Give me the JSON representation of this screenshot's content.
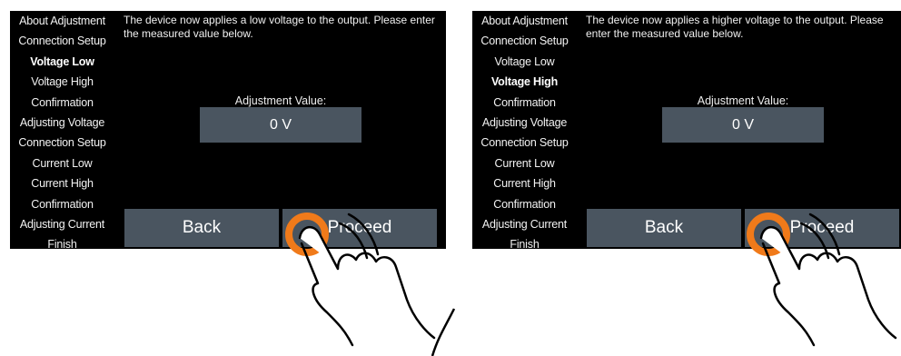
{
  "screens": [
    {
      "sidebar": {
        "items": [
          {
            "label": "About Adjustment",
            "active": false
          },
          {
            "label": "Connection Setup",
            "active": false
          },
          {
            "label": "Voltage Low",
            "active": true
          },
          {
            "label": "Voltage High",
            "active": false
          },
          {
            "label": "Confirmation",
            "active": false
          },
          {
            "label": "Adjusting Voltage",
            "active": false
          },
          {
            "label": "Connection Setup",
            "active": false
          },
          {
            "label": "Current Low",
            "active": false
          },
          {
            "label": "Current High",
            "active": false
          },
          {
            "label": "Confirmation",
            "active": false
          },
          {
            "label": "Adjusting Current",
            "active": false
          },
          {
            "label": "Finish",
            "active": false
          }
        ]
      },
      "message": "The device now applies a low voltage to the output. Please enter the measured value below.",
      "adjustment": {
        "label": "Adjustment Value:",
        "value": "0 V"
      },
      "buttons": {
        "back": "Back",
        "proceed": "Proceed"
      }
    },
    {
      "sidebar": {
        "items": [
          {
            "label": "About Adjustment",
            "active": false
          },
          {
            "label": "Connection Setup",
            "active": false
          },
          {
            "label": "Voltage Low",
            "active": false
          },
          {
            "label": "Voltage High",
            "active": true
          },
          {
            "label": "Confirmation",
            "active": false
          },
          {
            "label": "Adjusting Voltage",
            "active": false
          },
          {
            "label": "Connection Setup",
            "active": false
          },
          {
            "label": "Current Low",
            "active": false
          },
          {
            "label": "Current High",
            "active": false
          },
          {
            "label": "Confirmation",
            "active": false
          },
          {
            "label": "Adjusting Current",
            "active": false
          },
          {
            "label": "Finish",
            "active": false
          }
        ]
      },
      "message": "The device now applies a higher voltage to the output. Please enter the measured value below.",
      "adjustment": {
        "label": "Adjustment Value:",
        "value": "0 V"
      },
      "buttons": {
        "back": "Back",
        "proceed": "Proceed"
      }
    }
  ],
  "colors": {
    "screen_bg": "#000000",
    "panel": "#4a5560",
    "touch_ring": "#f07a1a"
  },
  "icons": {
    "tap_indicator": "hand-tap-icon"
  }
}
